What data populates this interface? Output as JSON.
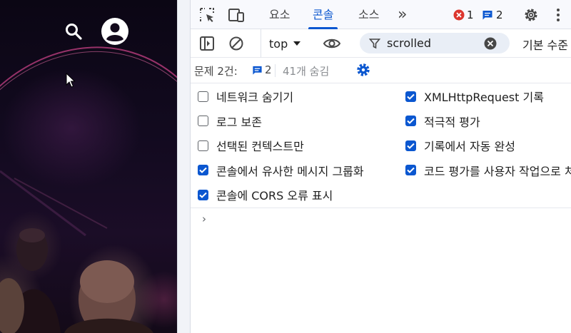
{
  "devtools": {
    "tabs": [
      {
        "label": "요소"
      },
      {
        "label": "콘솔"
      },
      {
        "label": "소스"
      }
    ],
    "more_tabs": "»",
    "error_count": "1",
    "message_count": "2",
    "toolbar": {
      "context": "top",
      "filter_value": "scrolled",
      "level_label": "기본 수준"
    },
    "issues": {
      "label": "문제 2건:",
      "count": "2",
      "hidden": "41개 숨김"
    },
    "settings_left": [
      {
        "label": "네트워크 숨기기",
        "checked": false
      },
      {
        "label": "로그 보존",
        "checked": false
      },
      {
        "label": "선택된 컨텍스트만",
        "checked": false
      },
      {
        "label": "콘솔에서 유사한 메시지 그룹화",
        "checked": true
      },
      {
        "label": "콘솔에 CORS 오류 표시",
        "checked": true
      }
    ],
    "settings_right": [
      {
        "label": "XMLHttpRequest 기록",
        "checked": true
      },
      {
        "label": "적극적 평가",
        "checked": true
      },
      {
        "label": "기록에서 자동 완성",
        "checked": true
      },
      {
        "label": "코드 평가를 사용자 작업으로 처리",
        "checked": true
      }
    ],
    "prompt": "›"
  },
  "colors": {
    "accent": "#0b57d0",
    "error": "#dc362e",
    "page_bg": "#130a1c"
  },
  "icons": [
    "search-icon",
    "account-icon",
    "inspect-icon",
    "device-toolbar-icon",
    "error-icon",
    "message-icon",
    "gear-icon",
    "more-vert-icon",
    "sidebar-icon",
    "clear-icon",
    "eye-icon",
    "filter-icon",
    "clear-filter-icon"
  ]
}
